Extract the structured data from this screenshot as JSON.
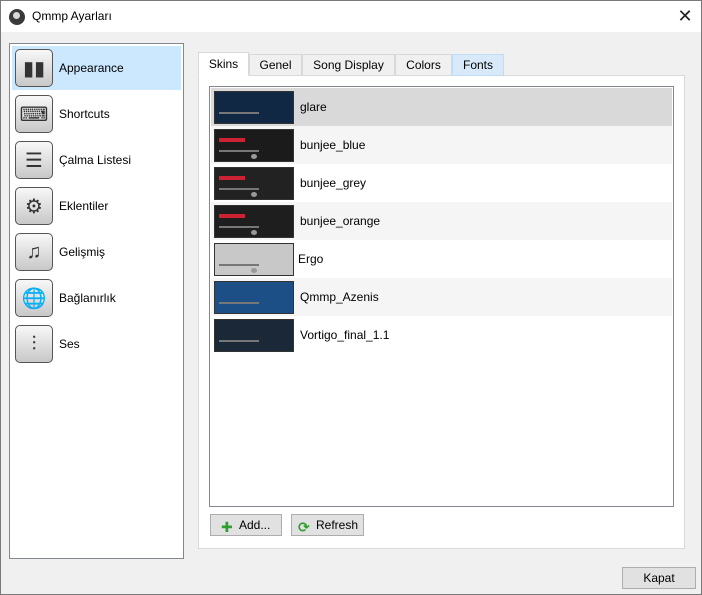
{
  "window": {
    "title": "Qmmp Ayarları",
    "close_glyph": "✕"
  },
  "sidebar": {
    "items": [
      {
        "label": "Appearance",
        "icon": "appearance-icon",
        "glyph": "▮▮",
        "selected": true
      },
      {
        "label": "Shortcuts",
        "icon": "shortcuts-icon",
        "glyph": "⌨"
      },
      {
        "label": "Çalma Listesi",
        "icon": "playlist-icon",
        "glyph": "☰"
      },
      {
        "label": "Eklentiler",
        "icon": "plugins-icon",
        "glyph": "⚙"
      },
      {
        "label": "Gelişmiş",
        "icon": "advanced-icon",
        "glyph": "♫"
      },
      {
        "label": "Bağlanırlık",
        "icon": "connectivity-icon",
        "glyph": "🌐"
      },
      {
        "label": "Ses",
        "icon": "audio-icon",
        "glyph": "⫶"
      }
    ]
  },
  "tabs": [
    {
      "label": "Skins",
      "active": true
    },
    {
      "label": "Genel"
    },
    {
      "label": "Song Display"
    },
    {
      "label": "Colors"
    },
    {
      "label": "Fonts",
      "hover": true
    }
  ],
  "skins": [
    {
      "name": "glare",
      "thumb_bg": "#102844",
      "selected": true
    },
    {
      "name": "bunjee_blue",
      "thumb_bg": "#1b1b1b"
    },
    {
      "name": "bunjee_grey",
      "thumb_bg": "#222222"
    },
    {
      "name": "bunjee_orange",
      "thumb_bg": "#1e1e1e"
    },
    {
      "name": "Ergo",
      "thumb_bg": "#c8c8c8"
    },
    {
      "name": "Qmmp_Azenis",
      "thumb_bg": "#1c4f86"
    },
    {
      "name": "Vortigo_final_1.1",
      "thumb_bg": "#1a2838"
    }
  ],
  "buttons": {
    "add": {
      "label": "Add...",
      "icon_glyph": "✚",
      "color": "#2e9e2e"
    },
    "refresh": {
      "label": "Refresh",
      "icon_glyph": "⟳",
      "color": "#2e9e2e"
    },
    "close": {
      "label": "Kapat"
    }
  }
}
